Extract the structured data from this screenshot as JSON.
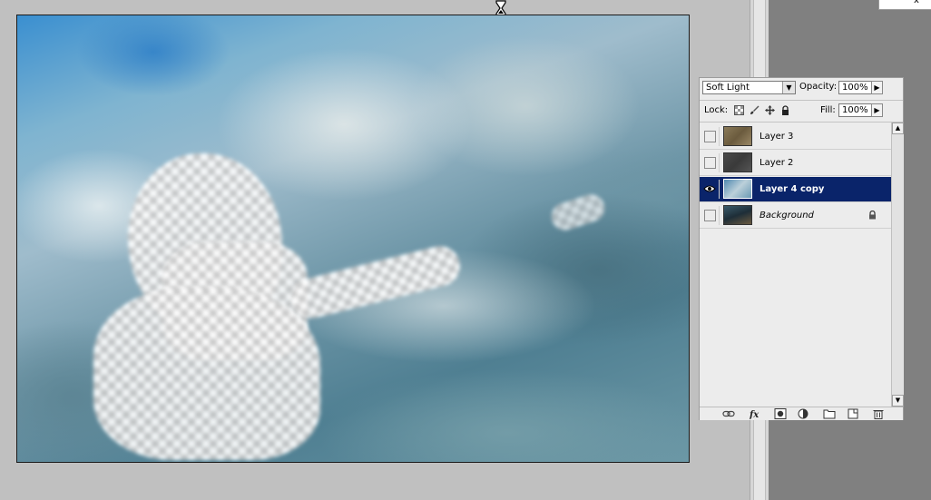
{
  "top_tab": {
    "label": "x"
  },
  "layers_panel": {
    "blend_mode": "Soft Light",
    "opacity_label": "Opacity:",
    "opacity_value": "100%",
    "lock_label": "Lock:",
    "fill_label": "Fill:",
    "fill_value": "100%",
    "layers": [
      {
        "name": "Layer 3",
        "visible": false,
        "selected": false
      },
      {
        "name": "Layer 2",
        "visible": false,
        "selected": false
      },
      {
        "name": "Layer 4 copy",
        "visible": true,
        "selected": true
      },
      {
        "name": "Background",
        "visible": false,
        "selected": false,
        "locked": true
      }
    ]
  },
  "icons": {
    "cursor": "hourglass-icon",
    "footer": [
      "link-layers-icon",
      "layer-style-icon",
      "layer-mask-icon",
      "adjustment-layer-icon",
      "new-group-icon",
      "new-layer-icon",
      "trash-icon"
    ],
    "lock": [
      "lock-transparent-icon",
      "lock-brush-icon",
      "lock-move-icon",
      "lock-all-icon"
    ]
  },
  "colors": {
    "selection": "#0a246a",
    "panel_bg": "#ececec",
    "workspace_bg": "#c0c0c0"
  }
}
